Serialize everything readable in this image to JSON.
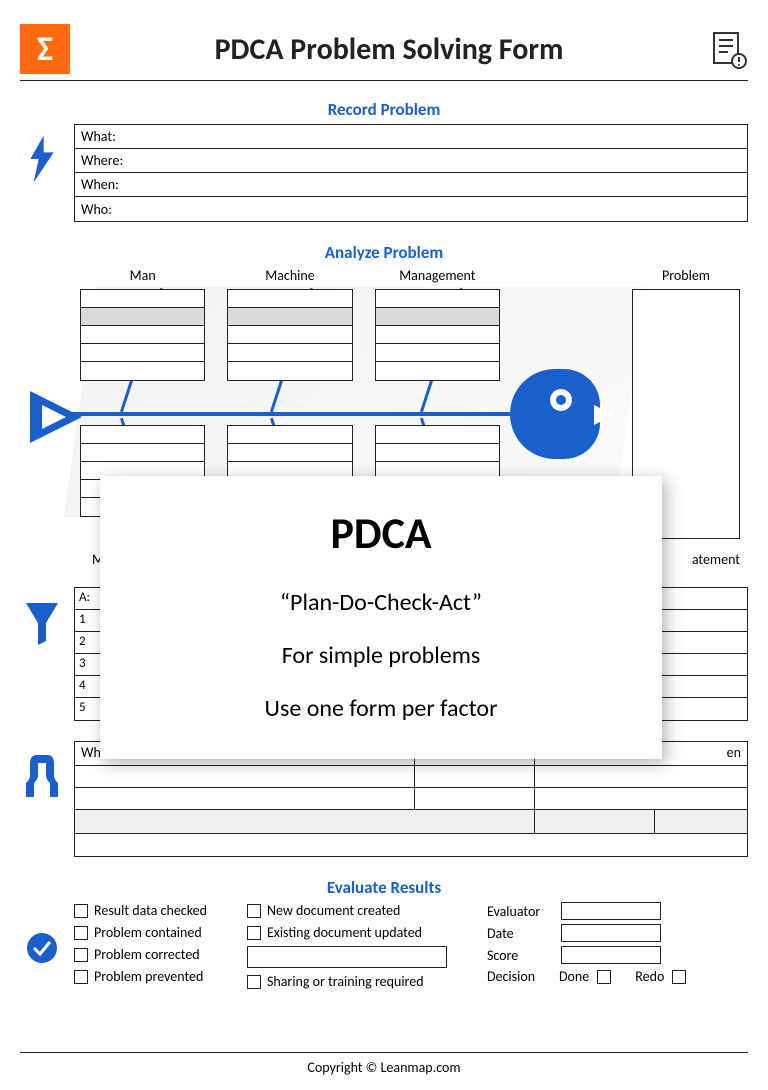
{
  "header": {
    "title": "PDCA Problem Solving Form"
  },
  "record": {
    "title": "Record Problem",
    "rows": [
      "What:",
      "Where:",
      "When:",
      "Who:"
    ]
  },
  "analyze": {
    "title": "Analyze Problem",
    "top_cats": [
      "Man",
      "Machine",
      "Management"
    ],
    "problem_label": "Problem",
    "meth_partial": "Me",
    "statement_partial": "atement"
  },
  "why": {
    "rows": [
      "A:",
      "1",
      "2",
      "3",
      "4",
      "5"
    ]
  },
  "actions": {
    "headers": {
      "what": "What",
      "when_partial": "en"
    }
  },
  "evaluate": {
    "title": "Evaluate Results",
    "col1": [
      "Result data checked",
      "Problem contained",
      "Problem corrected",
      "Problem prevented"
    ],
    "col2": [
      "New document created",
      "Existing document updated",
      "",
      "Sharing or training required"
    ],
    "fields": [
      "Evaluator",
      "Date",
      "Score"
    ],
    "decision_label": "Decision",
    "done": "Done",
    "redo": "Redo"
  },
  "overlay": {
    "heading": "PDCA",
    "line1": "“Plan-Do-Check-Act”",
    "line2": "For simple problems",
    "line3": "Use one form per factor"
  },
  "footer": "Copyright © Leanmap.com"
}
